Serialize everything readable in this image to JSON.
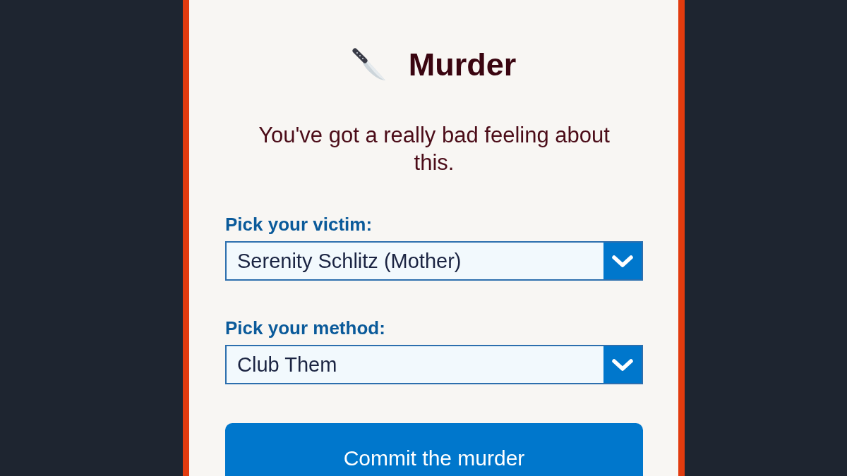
{
  "card": {
    "title": "Murder",
    "description": "You've got a really bad feeling about this.",
    "fields": [
      {
        "label": "Pick your victim:",
        "value": "Serenity Schlitz (Mother)"
      },
      {
        "label": "Pick your method:",
        "value": "Club Them"
      }
    ],
    "submit_button": "Commit the murder"
  }
}
